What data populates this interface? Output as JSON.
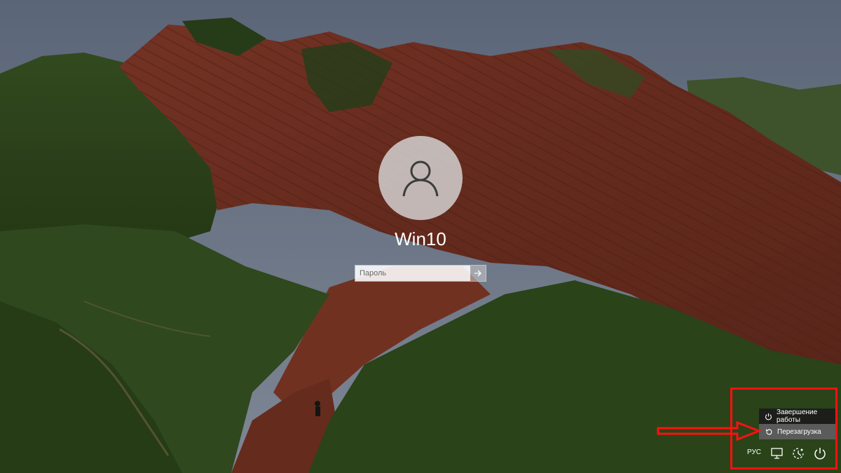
{
  "login": {
    "username": "Win10",
    "password_placeholder": "Пароль"
  },
  "power_menu": {
    "items": [
      {
        "label": "Завершение работы",
        "icon": "power-icon"
      },
      {
        "label": "Перезагрузка",
        "icon": "restart-icon"
      }
    ]
  },
  "tray": {
    "language": "РУС",
    "icons": [
      "network-icon",
      "ease-of-access-icon",
      "power-icon"
    ]
  },
  "colors": {
    "annotation": "#ff1010",
    "menu_background": "#1c1c1c",
    "menu_highlight": "#5f5f5f"
  }
}
